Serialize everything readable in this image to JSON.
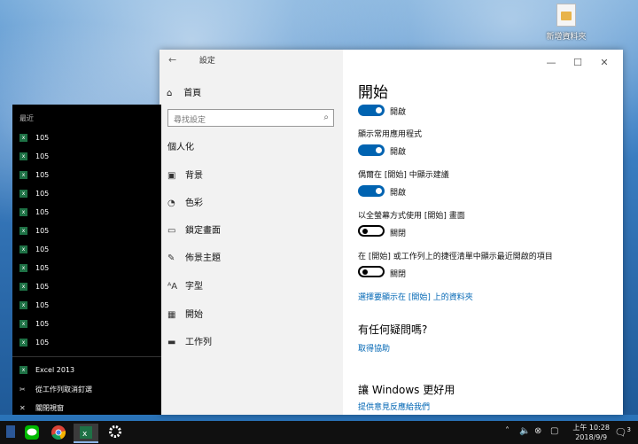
{
  "desktop": {
    "icon_label": "新增資料夾"
  },
  "settings": {
    "title": "設定",
    "home": "首頁",
    "search_placeholder": "尋找設定",
    "section": "個人化",
    "nav": [
      "背景",
      "色彩",
      "鎖定畫面",
      "佈景主題",
      "字型",
      "開始",
      "工作列"
    ],
    "heading": "開始",
    "options": [
      {
        "label": "",
        "state": "開啟",
        "on": true
      },
      {
        "label": "顯示常用應用程式",
        "state": "開啟",
        "on": true
      },
      {
        "label": "偶爾在 [開始] 中顯示建議",
        "state": "開啟",
        "on": true
      },
      {
        "label": "以全螢幕方式使用 [開始] 畫面",
        "state": "關閉",
        "on": false
      },
      {
        "label": "在 [開始] 或工作列上的捷徑清單中顯示最近開啟的項目",
        "state": "關閉",
        "on": false
      }
    ],
    "folders_link": "選擇要顯示在 [開始] 上的資料夾",
    "question_heading": "有任何疑問嗎?",
    "help_link": "取得協助",
    "improve_heading": "讓 Windows 更好用",
    "feedback_link": "提供意見反應給我們"
  },
  "jumplist": {
    "header": "最近",
    "items": [
      "105",
      "105",
      "105",
      "105",
      "105",
      "105",
      "105",
      "105",
      "105",
      "105",
      "105",
      "105"
    ],
    "app": "Excel 2013",
    "unpin": "從工作列取消釘選",
    "close": "關閉視窗"
  },
  "taskbar": {
    "time": "上午 10:28",
    "date": "2018/9/9",
    "notif_count": "3"
  }
}
